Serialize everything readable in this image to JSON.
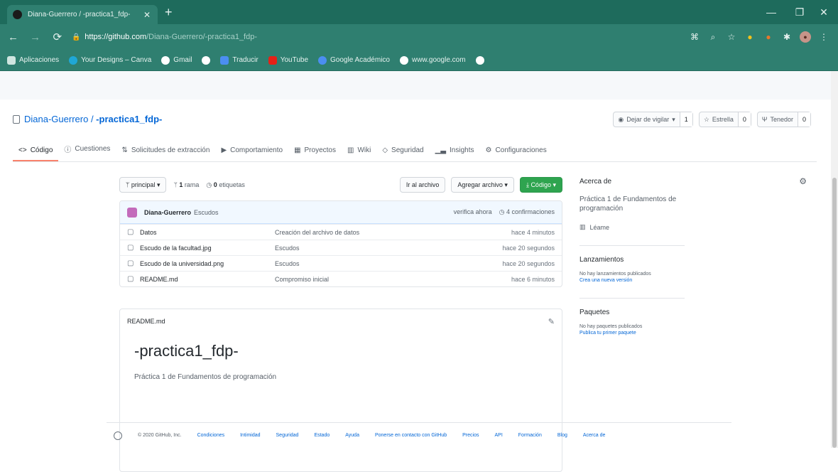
{
  "browser": {
    "tab_title": "Diana-Guerrero / -practica1_fdp-",
    "url_host": "https://github.com",
    "url_path": "/Diana-Guerrero/-practica1_fdp-",
    "bookmarks": [
      "Aplicaciones",
      "Your Designs – Canva",
      "Gmail",
      "Traducir",
      "YouTube",
      "Google Académico",
      "www.google.com"
    ]
  },
  "repo": {
    "owner": "Diana-Guerrero",
    "separator": " / ",
    "name": "-practica1_fdp-",
    "actions": {
      "watch_label": "Dejar de vigilar",
      "watch_count": "1",
      "star_label": "Estrella",
      "star_count": "0",
      "fork_label": "Tenedor",
      "fork_count": "0"
    },
    "nav": [
      "Código",
      "Cuestiones",
      "Solicitudes de extracción",
      "Comportamiento",
      "Proyectos",
      "Wiki",
      "Seguridad",
      "Insights",
      "Configuraciones"
    ]
  },
  "files": {
    "branch": "principal",
    "branches_count": "1",
    "branches_label": "rama",
    "tags_count": "0",
    "tags_label": "etiquetas",
    "goto_file": "Ir al archivo",
    "add_file": "Agregar archivo",
    "code_button": "Código",
    "latest_commit": {
      "author": "Diana-Guerrero",
      "message": "Escudos",
      "when": "verifica ahora",
      "commits": "4 confirmaciones"
    },
    "rows": [
      {
        "name": "Datos",
        "message": "Creación del archivo de datos",
        "age": "hace 4 minutos"
      },
      {
        "name": "Escudo de la facultad.jpg",
        "message": "Escudos",
        "age": "hace 20 segundos"
      },
      {
        "name": "Escudo de la universidad.png",
        "message": "Escudos",
        "age": "hace 20 segundos"
      },
      {
        "name": "README.md",
        "message": "Compromiso inicial",
        "age": "hace 6 minutos"
      }
    ]
  },
  "readme": {
    "filename": "README.md",
    "heading": "-practica1_fdp-",
    "body": "Práctica 1 de Fundamentos de programación"
  },
  "sidebar": {
    "about_title": "Acerca de",
    "description": "Práctica 1 de Fundamentos de programación",
    "readme_link": "Léame",
    "releases_title": "Lanzamientos",
    "releases_none": "No hay lanzamientos publicados",
    "releases_create": "Crea una nueva versión",
    "packages_title": "Paquetes",
    "packages_none": "No hay paquetes publicados",
    "packages_publish": "Publica tu primer paquete"
  },
  "footer": {
    "copyright": "© 2020 GitHub, Inc.",
    "links": [
      "Condiciones",
      "Intimidad",
      "Seguridad",
      "Estado",
      "Ayuda",
      "Ponerse en contacto con GitHub",
      "Precios",
      "API",
      "Formación",
      "Blog",
      "Acerca de"
    ]
  }
}
